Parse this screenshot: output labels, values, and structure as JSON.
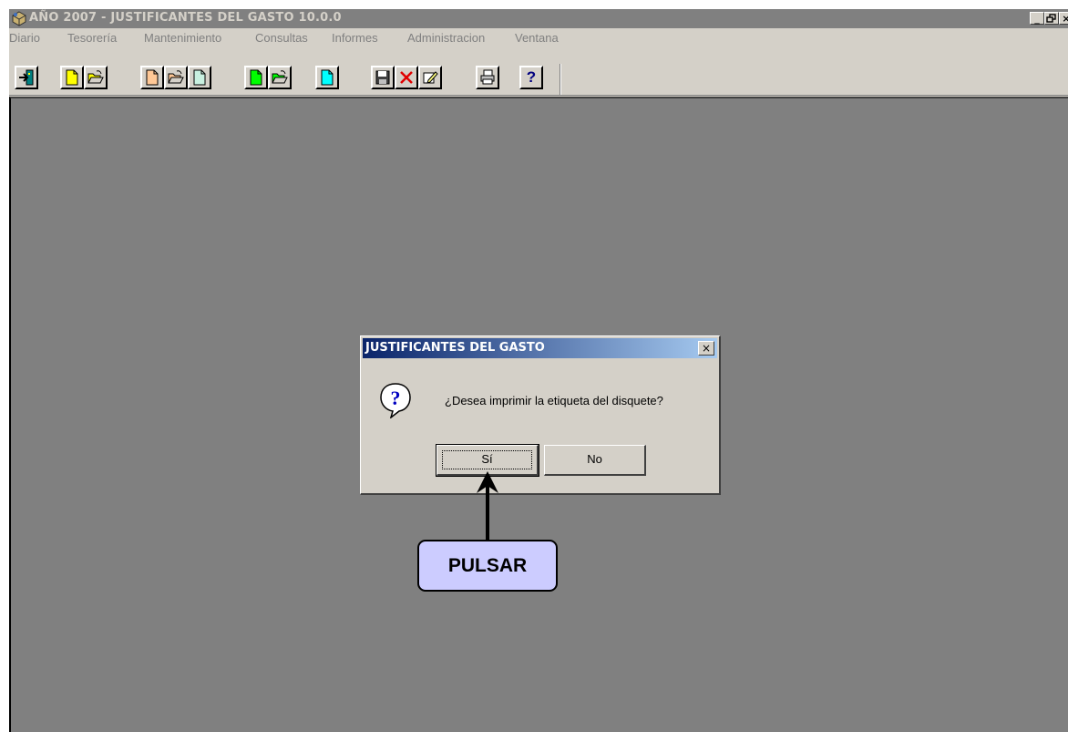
{
  "window": {
    "title": "AÑO 2007 - JUSTIFICANTES DEL GASTO 10.0.0",
    "controls": [
      "_",
      "🗗",
      "×"
    ]
  },
  "menu": {
    "items": [
      "Diario",
      "Tesorería",
      "Mantenimiento",
      "Consultas",
      "Informes",
      "Administracion",
      "Ventana"
    ]
  },
  "toolbar": {
    "help_glyph": "?"
  },
  "dialog": {
    "title": "JUSTIFICANTES DEL GASTO",
    "close_glyph": "×",
    "message": "¿Desea imprimir la etiqueta del disquete?",
    "icon": "question-icon",
    "yes_label": "Sí",
    "no_label": "No"
  },
  "annotation": {
    "label": "PULSAR"
  },
  "colors": {
    "title_bar_inactive": "#808080",
    "dialog_title_gradient_start": "#0a246a",
    "dialog_title_gradient_end": "#a6caf0",
    "workspace": "#808080",
    "callout_fill": "#ccccff"
  }
}
